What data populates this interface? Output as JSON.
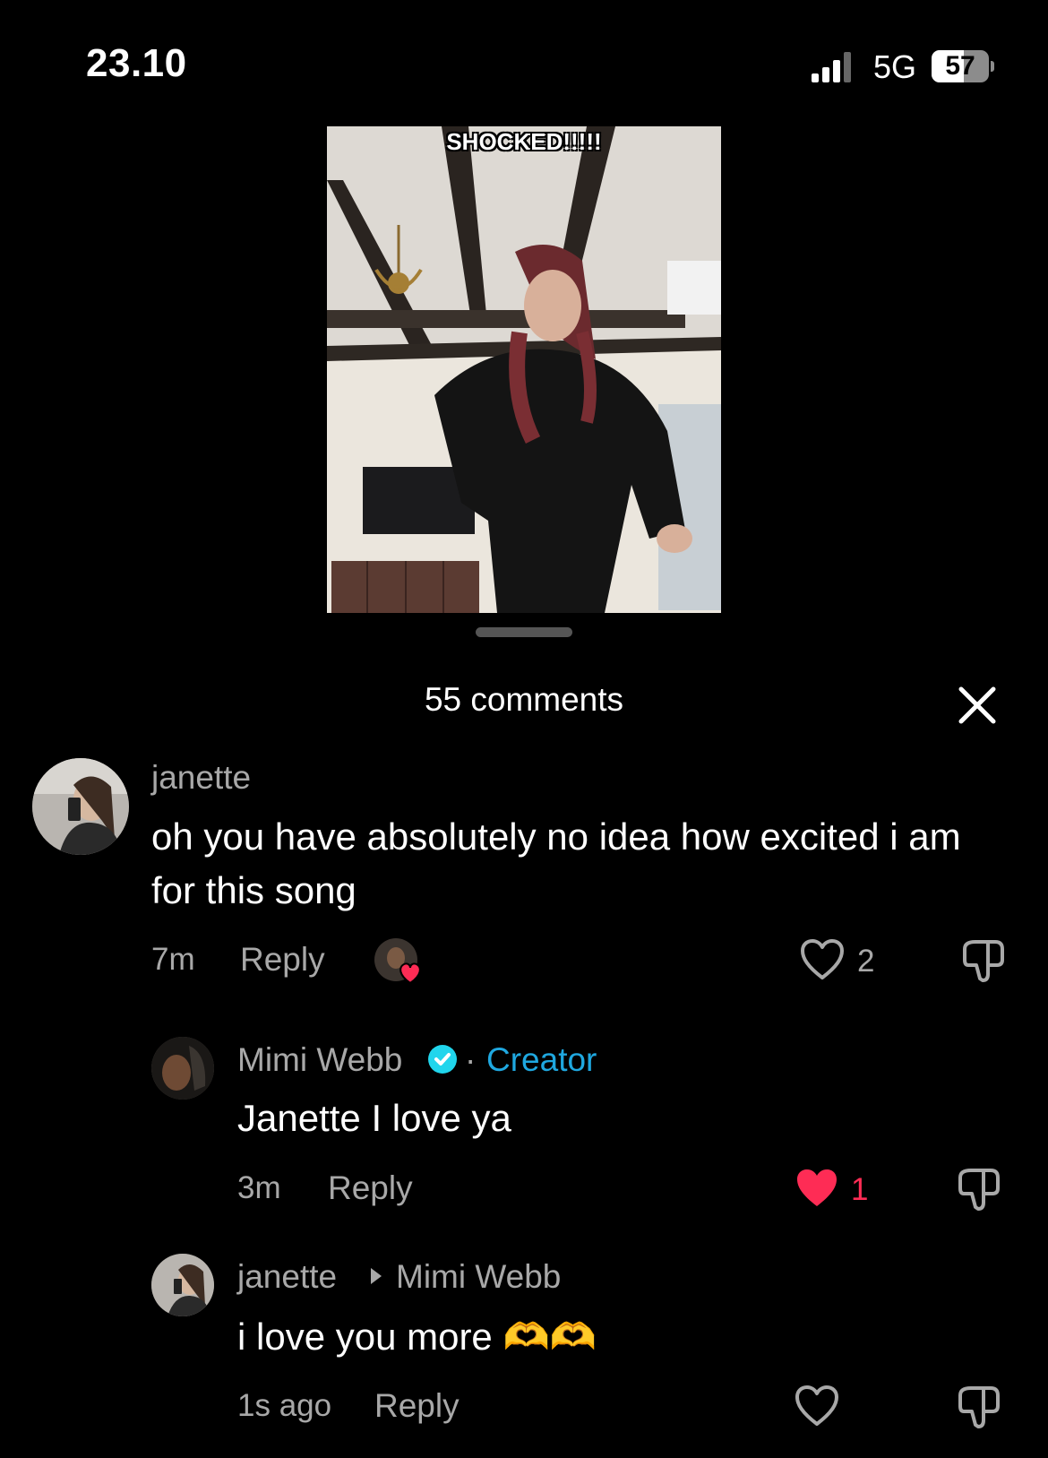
{
  "status_bar": {
    "time": "23.10",
    "network": "5G",
    "battery": "57",
    "battery_level": 0.57
  },
  "video": {
    "overlay_text": "SHOCKED!!!!!"
  },
  "comments_header": {
    "title": "55 comments"
  },
  "comments": [
    {
      "username": "janette",
      "text": "oh you have absolutely no idea how excited i am for this song",
      "time": "7m",
      "reply_label": "Reply",
      "likes": "2",
      "liked_by_creator": true
    },
    {
      "username": "Mimi Webb",
      "verified": true,
      "separator": "·",
      "badge": "Creator",
      "text": "Janette I love ya",
      "time": "3m",
      "reply_label": "Reply",
      "likes": "1",
      "liked": true
    },
    {
      "username": "janette",
      "reply_to": "Mimi Webb",
      "text": "i love you more 🫶🫶",
      "time": "1s ago",
      "reply_label": "Reply",
      "likes": ""
    }
  ],
  "colors": {
    "background": "#000000",
    "creator_blue": "#1fa8e0",
    "like_red": "#fe2c55",
    "muted_text": "#a8a8a8"
  }
}
